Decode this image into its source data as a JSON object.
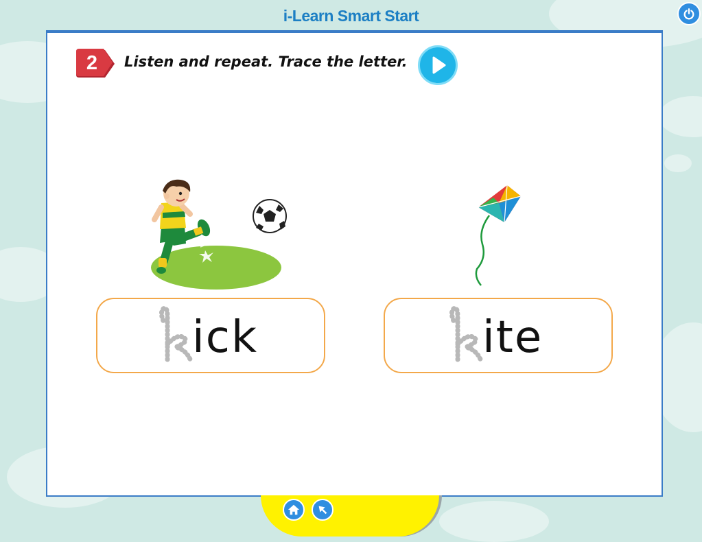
{
  "app": {
    "title": "i-Learn Smart Start"
  },
  "activity": {
    "number": "2",
    "instruction": "Listen and repeat. Trace the letter."
  },
  "words": [
    {
      "traced_letter": "k",
      "rest": "ick",
      "image": "boy-kicking-ball"
    },
    {
      "traced_letter": "k",
      "rest": "ite",
      "image": "kite"
    }
  ],
  "icons": {
    "power": "power-icon",
    "audio": "play-audio-icon",
    "home": "home-icon",
    "back": "back-icon"
  },
  "colors": {
    "title": "#1c7fc4",
    "badge": "#d93a42",
    "audio_button": "#1fb5e8",
    "box_border": "#f3a84a",
    "bottom_bar": "#fff200"
  }
}
